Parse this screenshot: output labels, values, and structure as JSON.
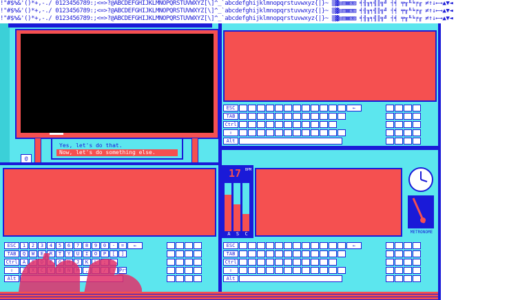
{
  "font_strip": {
    "rows": [
      "!\"#$%&'()*+,-./ 0123456789:;<=>?@ABCDEFGHIJKLMNOPQRSTUVWXYZ[\\]^_`abcdefghijklmnopqrstuvwxyz{|}~",
      "!\"#$%&'()*+,-./ 0123456789:;<=>?@ABCDEFGHIJKLMNOPQRSTUVWXYZ[\\]^_`abcdefghijklmnopqrstuvwxyz{|}~",
      "!\"#$%&'()*+,-./ 0123456789:;<=>?@ABCDEFGHIJKLMNOPQRSTUVWXYZ[\\]^_`abcdefghijklmnopqrstuvwxyz{|}~"
    ],
    "glyph_tail": "▒▓▤▥▦▧▨ ╡╢╖╕╣║╗╝ ┤╡ ╤╥╙╘╒╓ ≠↑↓←→▲▼◄"
  },
  "dialog": {
    "options": [
      "Yes, let's do that.",
      "Now, let's do something else."
    ],
    "selected_index": 1
  },
  "counter": {
    "value": "17",
    "unit": "BPM"
  },
  "meter_labels": [
    "A",
    "S",
    "C"
  ],
  "meter_levels": [
    0.75,
    0.55,
    0.35
  ],
  "metronome": {
    "label": "METRONOME"
  },
  "keyboard": {
    "row1": [
      "ESC",
      "1",
      "2",
      "3",
      "4",
      "5",
      "6",
      "7",
      "8",
      "9",
      "0",
      "-",
      "=",
      "←"
    ],
    "row2": [
      "TAB",
      "Q",
      "W",
      "E",
      "R",
      "T",
      "Y",
      "U",
      "I",
      "O",
      "P",
      "[",
      "]"
    ],
    "row3": [
      "Ctrl",
      "A",
      "S",
      "D",
      "F",
      "G",
      "H",
      "J",
      "K",
      "L",
      ";",
      "'"
    ],
    "row4": [
      "⇧",
      "Z",
      "X",
      "C",
      "V",
      "B",
      "N",
      "M",
      ",",
      ".",
      "/",
      "⇧",
      "Prt"
    ],
    "row5": [
      "Alt"
    ]
  },
  "colors": {
    "cyan": "#5ce6ee",
    "red": "#f55050",
    "blue": "#1a1ad8",
    "black": "#000000",
    "white": "#ffffff"
  }
}
